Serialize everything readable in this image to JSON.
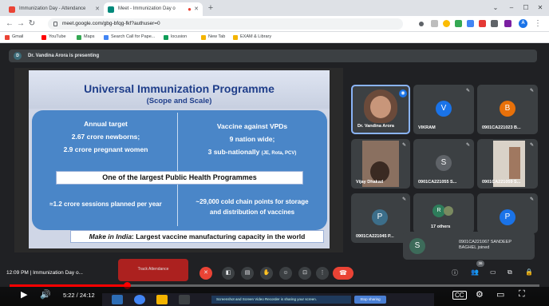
{
  "browser": {
    "tabs": [
      {
        "title": "Immunization Day - Attendance"
      },
      {
        "title": "Meet - Immunization Day o"
      }
    ],
    "new_tab": "+",
    "window_controls": [
      "–",
      "☐",
      "✕"
    ],
    "url": "meet.google.com/gbg-bfqg-fkf?authuser=0",
    "profile_letter": "A",
    "bookmarks": [
      "Gmail",
      "YouTube",
      "Maps",
      "Search Call for Pape...",
      "locusion",
      "New Tab",
      "EXAM & Library"
    ]
  },
  "meet": {
    "presenting_banner": "Dr. Vandina Arora is presenting",
    "presenter_initial": "D",
    "slide": {
      "title": "Universal Immunization Programme",
      "subtitle": "(Scope and Scale)",
      "left_heading": "Annual target",
      "left_line1": "2.67 crore newborns;",
      "left_line2": "2.9 crore pregnant women",
      "right_heading": "Vaccine against VPDs",
      "right_line1": "9 nation wide;",
      "right_line2": "3 sub-nationally",
      "right_line2_small": "(JE, Rota, PCV)",
      "middle_banner": "One of the largest Public Health Programmes",
      "bottom_left": "≈1.2 crore sessions planned per year",
      "bottom_right_1": "~29,000 cold chain points for storage",
      "bottom_right_2": "and distribution of vaccines",
      "footer_italic": "Make in India",
      "footer_rest": ": Largest vaccine manufacturing capacity in the world"
    },
    "participants": [
      {
        "name": "Dr. Vandina Arora",
        "initial": "",
        "color": ""
      },
      {
        "name": "VIKRAM",
        "initial": "V",
        "color": "#1a73e8"
      },
      {
        "name": "0901CA221023 B...",
        "initial": "B",
        "color": "#e8710a"
      },
      {
        "name": "Vijay Dhakad",
        "initial": "",
        "color": ""
      },
      {
        "name": "0901CA221055 S...",
        "initial": "S",
        "color": "#5f6368"
      },
      {
        "name": "0901CA221059 S...",
        "initial": "",
        "color": ""
      },
      {
        "name": "0901CA221045 P...",
        "initial": "P",
        "color": "#3c6e8a"
      },
      {
        "name": "17 others",
        "initial": "R",
        "color": "#2e7d5b"
      },
      {
        "name": "",
        "initial": "P",
        "color": "#1a73e8"
      }
    ],
    "toast": {
      "initial": "S",
      "line1": "0901CA221067 SANDEEP",
      "line2": "BAGHEL joined"
    },
    "time_label": "12:09 PM  |  Immunization Day o...",
    "track_attendance": "Track Attendance",
    "participant_count": "36"
  },
  "player": {
    "time": "5:22 / 24:12",
    "progress": 0.222
  },
  "taskbar": {
    "notification": "Screenshot and Screen Video Recorder is sharing your screen.",
    "stop_sharing": "Stop sharing"
  },
  "colors": {
    "slide_title": "#1f3e8a",
    "panel": "#4a86c8",
    "end_call": "#ea4335",
    "progress": "#ff0000"
  }
}
